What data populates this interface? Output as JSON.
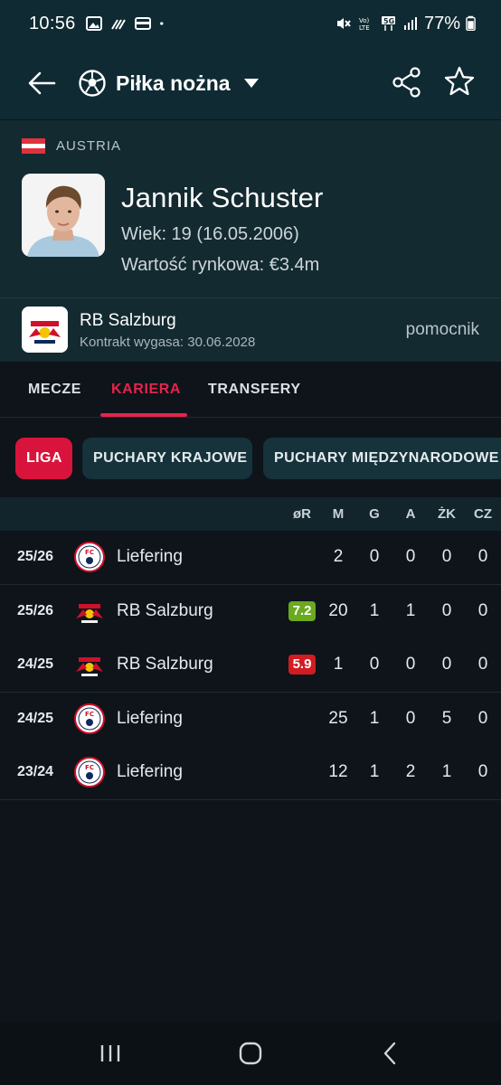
{
  "status_bar": {
    "time": "10:56",
    "battery": "77%"
  },
  "app_bar": {
    "sport": "Piłka nożna"
  },
  "player": {
    "country": "AUSTRIA",
    "name": "Jannik Schuster",
    "age": "Wiek: 19 (16.05.2006)",
    "market_value": "Wartość rynkowa: €3.4m",
    "club": "RB Salzburg",
    "contract": "Kontrakt wygasa: 30.06.2028",
    "position": "pomocnik"
  },
  "tabs": [
    {
      "label": "MECZE",
      "active": false
    },
    {
      "label": "KARIERA",
      "active": true
    },
    {
      "label": "TRANSFERY",
      "active": false
    }
  ],
  "chips": [
    {
      "label": "LIGA",
      "active": true
    },
    {
      "label": "PUCHARY KRAJOWE",
      "active": false
    },
    {
      "label": "PUCHARY MIĘDZYNARODOWE",
      "active": false
    }
  ],
  "table": {
    "columns": [
      "øR",
      "M",
      "G",
      "A",
      "ŻK",
      "CZ"
    ],
    "rows": [
      {
        "season": "25/26",
        "team": "Liefering",
        "logo": "liefering-logo",
        "rating": "",
        "m": "2",
        "g": "0",
        "a": "0",
        "zk": "0",
        "cz": "0"
      },
      {
        "season": "25/26",
        "team": "RB Salzburg",
        "logo": "salzburg-logo",
        "rating": "7.2",
        "rating_color": "#6aaa1e",
        "m": "20",
        "g": "1",
        "a": "1",
        "zk": "0",
        "cz": "0"
      },
      {
        "season": "24/25",
        "team": "RB Salzburg",
        "logo": "salzburg-logo",
        "rating": "5.9",
        "rating_color": "#d21c22",
        "m": "1",
        "g": "0",
        "a": "0",
        "zk": "0",
        "cz": "0"
      },
      {
        "season": "24/25",
        "team": "Liefering",
        "logo": "liefering-logo",
        "rating": "",
        "m": "25",
        "g": "1",
        "a": "0",
        "zk": "5",
        "cz": "0"
      },
      {
        "season": "23/24",
        "team": "Liefering",
        "logo": "liefering-logo",
        "rating": "",
        "m": "12",
        "g": "1",
        "a": "2",
        "zk": "1",
        "cz": "0"
      }
    ]
  },
  "colors": {
    "accent": "#e4244b",
    "header_bg": "#0f2a33",
    "background": "#0e141a"
  }
}
